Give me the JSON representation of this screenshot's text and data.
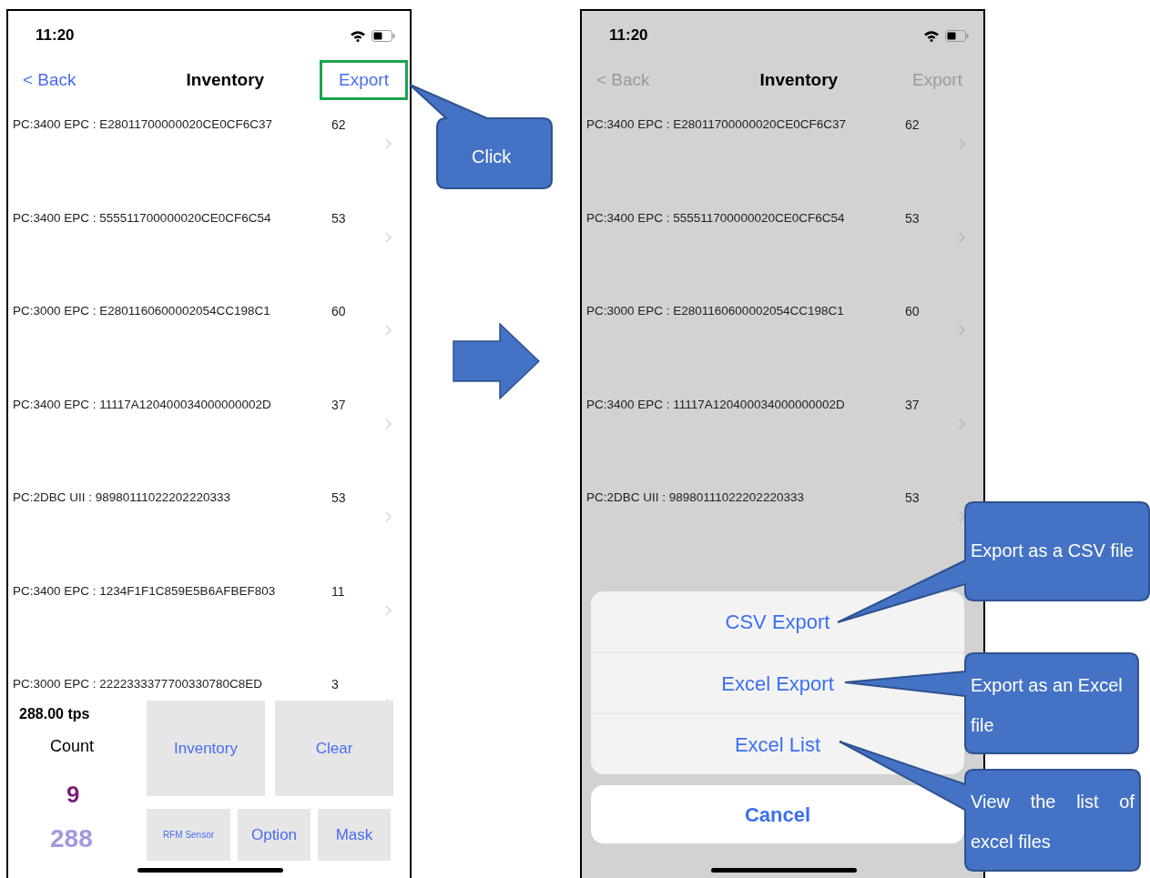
{
  "screens": [
    {
      "dimmed": false,
      "time": "11:20",
      "nav": {
        "back": "< Back",
        "title": "Inventory",
        "action": "Export",
        "action_highlighted": true
      },
      "rows": [
        {
          "tag": "PC:3400 EPC : E28011700000020CE0CF6C37",
          "count": "62"
        },
        {
          "tag": "PC:3400 EPC : 555511700000020CE0CF6C54",
          "count": "53"
        },
        {
          "tag": "PC:3000 EPC : E2801160600002054CC198C1",
          "count": "60"
        },
        {
          "tag": "PC:3400 EPC : 11117A120400034000000002D",
          "count": "37"
        },
        {
          "tag": "PC:2DBC UII : 98980111022202220333",
          "count": "53"
        },
        {
          "tag": "PC:3400 EPC : 1234F1F1C859E5B6AFBEF803",
          "count": "11"
        },
        {
          "tag": "PC:3000 EPC : 2222333377700330780C8ED",
          "count": "3"
        }
      ],
      "footer": {
        "rate": "288.00 tps",
        "count_label": "Count",
        "unique": "9",
        "total": "288",
        "buttons": [
          {
            "label": "Inventory",
            "kind": "large"
          },
          {
            "label": "Clear",
            "kind": "large"
          },
          {
            "label": "RFM Sensor",
            "kind": "tiny"
          },
          {
            "label": "Option",
            "kind": "small"
          },
          {
            "label": "Mask",
            "kind": "small"
          }
        ]
      }
    },
    {
      "dimmed": true,
      "time": "11:20",
      "nav": {
        "back": "< Back",
        "title": "Inventory",
        "action": "Export",
        "action_highlighted": false
      },
      "rows": [
        {
          "tag": "PC:3400 EPC : E28011700000020CE0CF6C37",
          "count": "62"
        },
        {
          "tag": "PC:3400 EPC : 555511700000020CE0CF6C54",
          "count": "53"
        },
        {
          "tag": "PC:3000 EPC : E2801160600002054CC198C1",
          "count": "60"
        },
        {
          "tag": "PC:3400 EPC : 11117A120400034000000002D",
          "count": "37"
        },
        {
          "tag": "PC:2DBC UII : 98980111022202220333",
          "count": "53"
        }
      ],
      "action_sheet": {
        "items": [
          "CSV Export",
          "Excel Export",
          "Excel List"
        ],
        "cancel": "Cancel"
      }
    }
  ],
  "callouts": [
    {
      "text": "Click"
    },
    {
      "text": "Export as a CSV file"
    },
    {
      "text": "Export as an Excel file"
    },
    {
      "text": "View the list of excel files"
    }
  ]
}
